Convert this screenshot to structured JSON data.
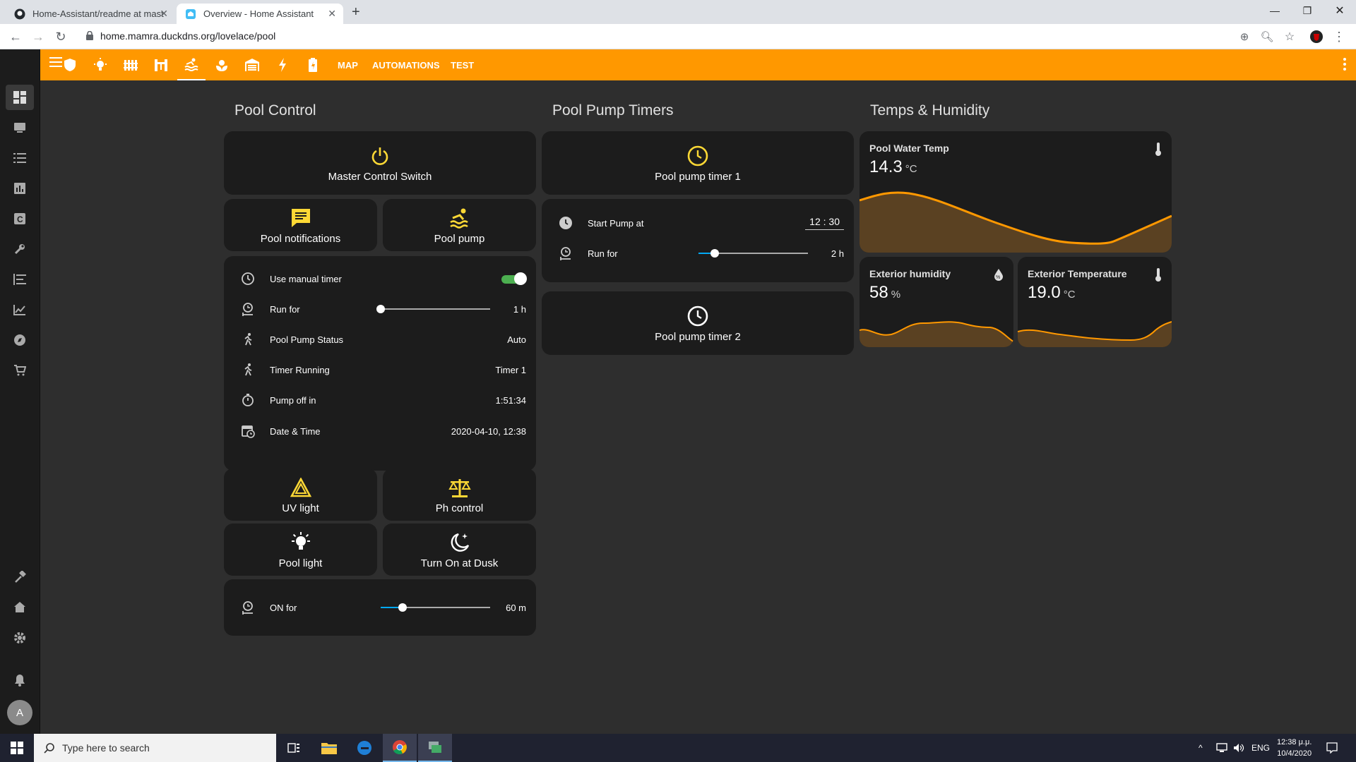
{
  "browser": {
    "tabs": [
      {
        "title": "Home-Assistant/readme at mast",
        "active": false
      },
      {
        "title": "Overview - Home Assistant",
        "active": true
      }
    ],
    "new_tab": "+",
    "url": "home.mamra.duckdns.org/lovelace/pool"
  },
  "header": {
    "tabs_text": {
      "map": "MAP",
      "automations": "AUTOMATIONS",
      "test": "TEST"
    },
    "icons": [
      "shield-icon",
      "lightbulb-icon",
      "fence-icon",
      "gate-icon",
      "pool-icon",
      "flower-icon",
      "garage-icon",
      "flash-icon",
      "battery-icon"
    ],
    "accent_color": "#ff9800"
  },
  "columns": {
    "pool_control": {
      "title": "Pool Control",
      "master": "Master Control Switch",
      "notifications": "Pool notifications",
      "pump": "Pool pump",
      "rows": {
        "manual_timer": "Use manual timer",
        "run_for": "Run for",
        "run_for_value": "1 h",
        "status": "Pool Pump Status",
        "status_value": "Auto",
        "timer_running": "Timer Running",
        "timer_running_value": "Timer 1",
        "pump_off": "Pump off in",
        "pump_off_value": "1:51:34",
        "datetime": "Date & Time",
        "datetime_value": "2020-04-10, 12:38"
      },
      "manual_timer_on": true,
      "run_for_level": 0.0,
      "uv": "UV light",
      "ph": "Ph control",
      "pool_light": "Pool light",
      "dusk": "Turn On at Dusk",
      "on_for": "ON for",
      "on_for_value": "60 m",
      "on_for_level": 0.2
    },
    "pump_timers": {
      "title": "Pool Pump Timers",
      "timer1": "Pool pump timer 1",
      "start_at": "Start Pump at",
      "start_time": "12 : 30",
      "run_for": "Run for",
      "run_for_value": "2 h",
      "run_for_level": 0.15,
      "timer2": "Pool pump timer 2"
    },
    "temps": {
      "title": "Temps & Humidity",
      "water": {
        "name": "Pool Water Temp",
        "value": "14.3",
        "unit": "°C"
      },
      "humidity": {
        "name": "Exterior humidity",
        "value": "58",
        "unit": "%"
      },
      "ext_temp": {
        "name": "Exterior Temperature",
        "value": "19.0",
        "unit": "°C"
      }
    }
  },
  "sidebar": {
    "avatar": "A"
  },
  "taskbar": {
    "search_placeholder": "Type here to search",
    "lang": "ENG",
    "time": "12:38 μ.μ.",
    "date": "10/4/2020"
  }
}
